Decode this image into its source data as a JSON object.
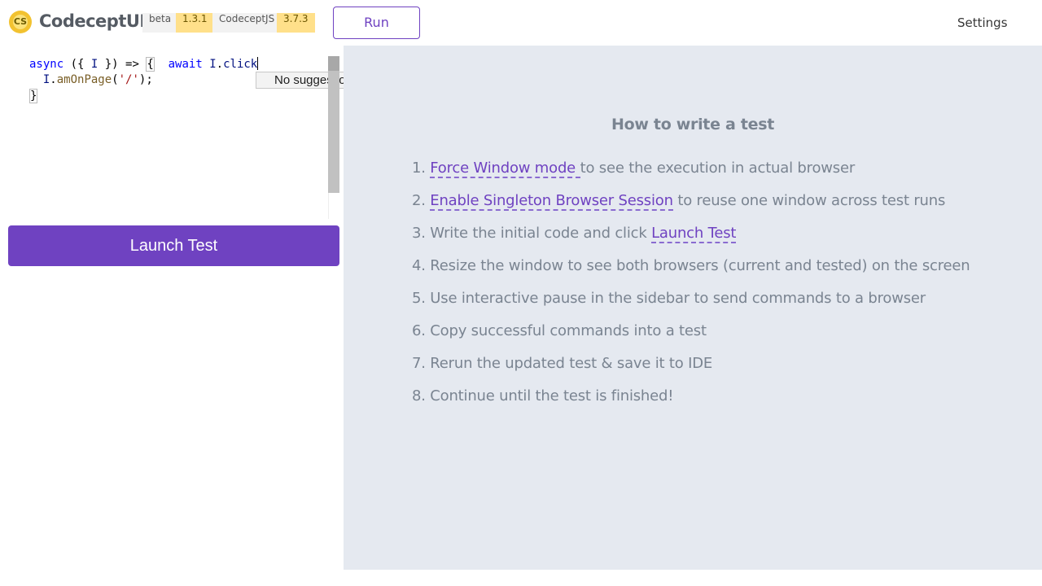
{
  "header": {
    "logo_glyph": "CS",
    "brand": "CodeceptUI",
    "beta_label": "beta",
    "ui_version": "1.3.1",
    "codeceptjs_label": "CodeceptJS",
    "codeceptjs_version": "3.7.3",
    "run_label": "Run",
    "settings_label": "Settings"
  },
  "editor": {
    "line1": {
      "kw": "async",
      "p1": " ({ ",
      "param": "I",
      "p2": " }) => ",
      "brace": "{",
      "p3": "  ",
      "await": "await",
      "sp": " ",
      "obj": "I",
      "dot": ".",
      "method": "click"
    },
    "line2": {
      "indent": "  ",
      "obj": "I",
      "dot": ".",
      "method": "amOnPage",
      "open": "(",
      "str": "'/'",
      "close": ");"
    },
    "line3": "}",
    "suggestion": "No suggestions."
  },
  "launch_label": "Launch Test",
  "howto": {
    "title": "How to write a test",
    "steps": [
      {
        "num": "1. ",
        "link": "Force Window mode ",
        "text": "to see the execution in actual browser"
      },
      {
        "num": "2. ",
        "link": "Enable Singleton Browser Session",
        "text": " to reuse one window across test runs"
      },
      {
        "num": "3. ",
        "pre": "Write the initial code and click ",
        "link": "Launch Test"
      },
      {
        "num": "4. ",
        "text": "Resize the window to see both browsers (current and tested) on the screen"
      },
      {
        "num": "5. ",
        "text": "Use interactive pause in the sidebar to send commands to a browser"
      },
      {
        "num": "6. ",
        "text": "Copy successful commands into a test"
      },
      {
        "num": "7. ",
        "text": "Rerun the updated test & save it to IDE"
      },
      {
        "num": "8. ",
        "text": "Continue until the test is finished!"
      }
    ]
  },
  "colors": {
    "accent": "#6f42c1",
    "panel_bg": "#e5e9f0",
    "version_badge": "#ffe08a"
  },
  "icons": {
    "logo": "codeceptjs-logo-icon"
  }
}
